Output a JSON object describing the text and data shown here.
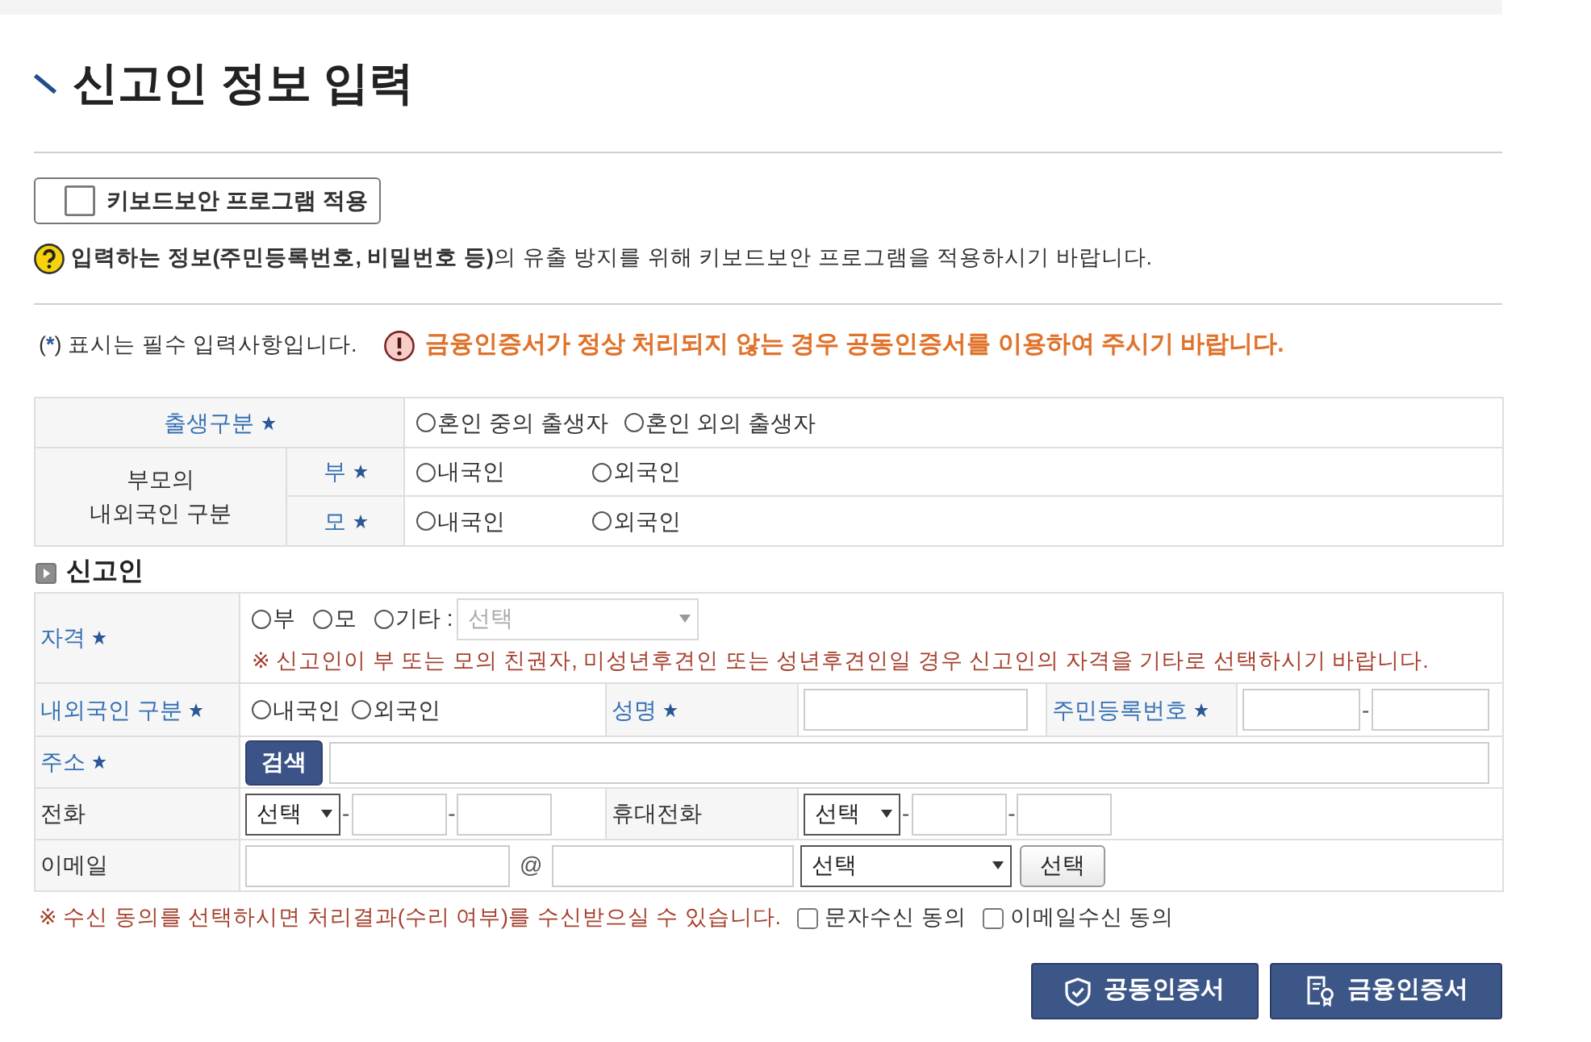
{
  "title": "신고인 정보 입력",
  "keyboard_security": {
    "label": "키보드보안 프로그램 적용",
    "checked": false
  },
  "notice": "**입력하는 정보(주민등록번호, 비밀번호 등)**의 유출 방지를 위해 키보드보안 프로그램을 적용하시기 바랍니다.",
  "required_note": {
    "open": "(",
    "mark": "*",
    "close": ") 표시는 필수 입력사항입니다."
  },
  "warning": "금융인증서가 정상 처리되지 않는 경우 공동인증서를 이용하여 주시기 바랍니다.",
  "birth_table": {
    "birth_type": {
      "label": "출생구분",
      "required": true,
      "options": [
        {
          "label": "혼인 중의 출생자",
          "selected": false
        },
        {
          "label": "혼인 외의 출생자",
          "selected": false
        }
      ]
    },
    "parent_nationality": {
      "label_lines": [
        "부모의",
        "내외국인 구분"
      ],
      "rows": [
        {
          "label": "부",
          "required": true,
          "options": [
            {
              "label": "내국인",
              "selected": false
            },
            {
              "label": "외국인",
              "selected": false
            }
          ]
        },
        {
          "label": "모",
          "required": true,
          "options": [
            {
              "label": "내국인",
              "selected": false
            },
            {
              "label": "외국인",
              "selected": false
            }
          ]
        }
      ]
    }
  },
  "reporter": {
    "heading": "신고인",
    "qualification": {
      "label": "자격",
      "required": true,
      "options": [
        {
          "label": "부",
          "selected": false
        },
        {
          "label": "모",
          "selected": false
        },
        {
          "label": "기타 :",
          "selected": false
        }
      ],
      "other_select": {
        "value": "선택",
        "disabled": true
      },
      "note": "※ 신고인이 부 또는 모의 친권자, 미성년후견인 또는 성년후견인일 경우 신고인의 자격을 기타로 선택하시기 바랍니다."
    },
    "nationality": {
      "label": "내외국인 구분",
      "required": true,
      "options": [
        {
          "label": "내국인",
          "selected": false
        },
        {
          "label": "외국인",
          "selected": false
        }
      ]
    },
    "name": {
      "label": "성명",
      "required": true
    },
    "resident_number": {
      "label": "주민등록번호",
      "required": true,
      "separator": "-"
    },
    "address": {
      "label": "주소",
      "required": true,
      "search_button": "검색"
    },
    "phone": {
      "label": "전화",
      "required": false,
      "select": "선택",
      "separators": [
        "-",
        "-"
      ]
    },
    "mobile": {
      "label": "휴대전화",
      "required": false,
      "select": "선택",
      "separators": [
        "-",
        "-"
      ]
    },
    "email": {
      "label": "이메일",
      "required": false,
      "at": "@",
      "domain_select": "선택",
      "select_button": "선택"
    }
  },
  "consent": {
    "note": "※ 수신 동의를 선택하시면 처리결과(수리 여부)를 수신받으실 수 있습니다.",
    "options": [
      {
        "label": "문자수신 동의",
        "checked": false
      },
      {
        "label": "이메일수신 동의",
        "checked": false
      }
    ]
  },
  "buttons": [
    {
      "label": "공동인증서",
      "kind": "shield"
    },
    {
      "label": "금융인증서",
      "kind": "certificate"
    }
  ]
}
